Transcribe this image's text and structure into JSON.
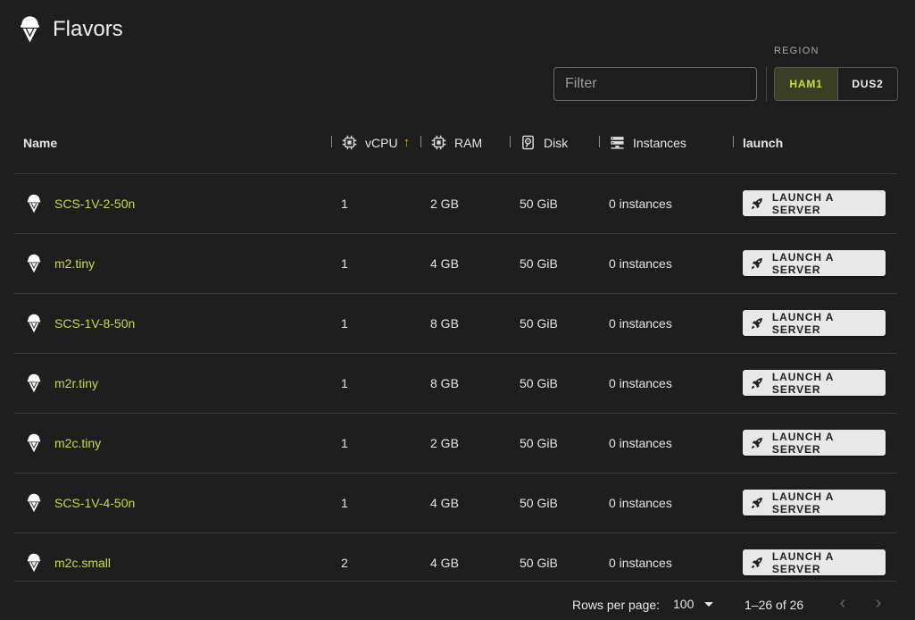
{
  "page": {
    "title": "Flavors"
  },
  "filter": {
    "placeholder": "Filter"
  },
  "region": {
    "label": "REGION",
    "options": [
      {
        "label": "HAM1",
        "active": true
      },
      {
        "label": "DUS2",
        "active": false
      }
    ]
  },
  "table": {
    "columns": {
      "name": "Name",
      "vcpu": "vCPU",
      "ram": "RAM",
      "disk": "Disk",
      "instances": "Instances",
      "launch": "launch"
    },
    "sort": {
      "column": "vcpu",
      "direction": "asc"
    },
    "rows": [
      {
        "name": "SCS-1V-2-50n",
        "vcpu": "1",
        "ram": "2 GB",
        "disk": "50 GiB",
        "instances": "0 instances",
        "action": "LAUNCH A SERVER"
      },
      {
        "name": "m2.tiny",
        "vcpu": "1",
        "ram": "4 GB",
        "disk": "50 GiB",
        "instances": "0 instances",
        "action": "LAUNCH A SERVER"
      },
      {
        "name": "SCS-1V-8-50n",
        "vcpu": "1",
        "ram": "8 GB",
        "disk": "50 GiB",
        "instances": "0 instances",
        "action": "LAUNCH A SERVER"
      },
      {
        "name": "m2r.tiny",
        "vcpu": "1",
        "ram": "8 GB",
        "disk": "50 GiB",
        "instances": "0 instances",
        "action": "LAUNCH A SERVER"
      },
      {
        "name": "m2c.tiny",
        "vcpu": "1",
        "ram": "2 GB",
        "disk": "50 GiB",
        "instances": "0 instances",
        "action": "LAUNCH A SERVER"
      },
      {
        "name": "SCS-1V-4-50n",
        "vcpu": "1",
        "ram": "4 GB",
        "disk": "50 GiB",
        "instances": "0 instances",
        "action": "LAUNCH A SERVER"
      },
      {
        "name": "m2c.small",
        "vcpu": "2",
        "ram": "4 GB",
        "disk": "50 GiB",
        "instances": "0 instances",
        "action": "LAUNCH A SERVER"
      }
    ]
  },
  "pagination": {
    "rows_per_page_label": "Rows per page:",
    "rows_per_page": "100",
    "range": "1–26 of 26"
  },
  "colors": {
    "accent": "#cddc39",
    "sort_arrow": "#f0a020",
    "background": "#1e1e1e"
  }
}
